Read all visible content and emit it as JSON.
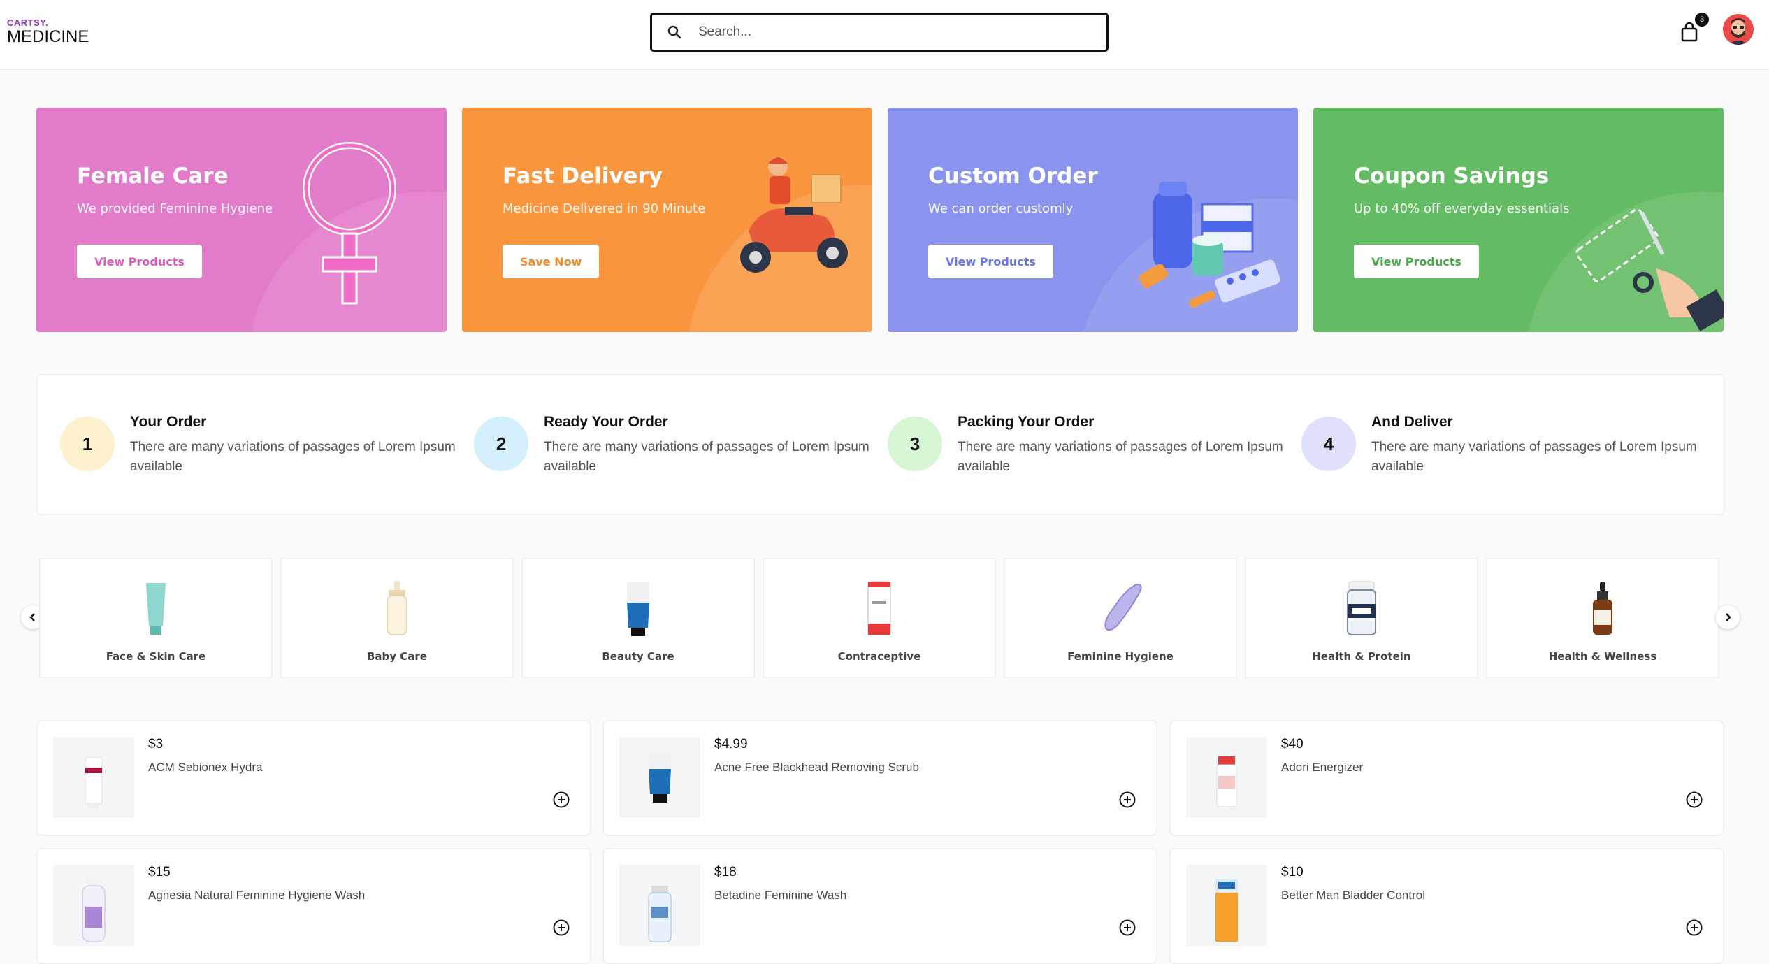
{
  "header": {
    "brand_small": "CARTSY.",
    "brand_name": "MEDICINE",
    "search_placeholder": "Search...",
    "cart_count": "3",
    "icons": [
      "search-icon",
      "shopping-bag-icon",
      "avatar"
    ]
  },
  "banners": [
    {
      "title": "Female Care",
      "subtitle": "We provided Feminine Hygiene",
      "button": "View Products",
      "color": "#e27bca",
      "accent": "#e05cb8"
    },
    {
      "title": "Fast Delivery",
      "subtitle": "Medicine Delivered in 90 Minute",
      "button": "Save Now",
      "color": "#f9963d",
      "accent": "#f28a2a"
    },
    {
      "title": "Custom Order",
      "subtitle": "We can order customly",
      "button": "View Products",
      "color": "#8a94ee",
      "accent": "#6a76e6"
    },
    {
      "title": "Coupon Savings",
      "subtitle": "Up to 40% off everyday essentials",
      "button": "View Products",
      "color": "#63bb63",
      "accent": "#4aa64a"
    }
  ],
  "steps": [
    {
      "num": "1",
      "title": "Your Order",
      "desc": "There are many variations of passages of Lorem Ipsum available",
      "color": "#fdf0cc"
    },
    {
      "num": "2",
      "title": "Ready Your Order",
      "desc": "There are many variations of passages of Lorem Ipsum available",
      "color": "#d4effc"
    },
    {
      "num": "3",
      "title": "Packing Your Order",
      "desc": "There are many variations of passages of Lorem Ipsum available",
      "color": "#d6f5d3"
    },
    {
      "num": "4",
      "title": "And Deliver",
      "desc": "There are many variations of passages of Lorem Ipsum available",
      "color": "#dfe0fb"
    }
  ],
  "categories": [
    {
      "label": "Face & Skin Care"
    },
    {
      "label": "Baby Care"
    },
    {
      "label": "Beauty Care"
    },
    {
      "label": "Contraceptive"
    },
    {
      "label": "Feminine Hygiene"
    },
    {
      "label": "Health & Protein"
    },
    {
      "label": "Health & Wellness"
    }
  ],
  "products": [
    {
      "price": "$3",
      "name": "ACM Sebionex Hydra"
    },
    {
      "price": "$4.99",
      "name": "Acne Free Blackhead Removing Scrub"
    },
    {
      "price": "$40",
      "name": "Adori Energizer"
    },
    {
      "price": "$15",
      "name": "Agnesia Natural Feminine Hygiene Wash"
    },
    {
      "price": "$18",
      "name": "Betadine Feminine Wash"
    },
    {
      "price": "$10",
      "name": "Better Man Bladder Control"
    }
  ]
}
